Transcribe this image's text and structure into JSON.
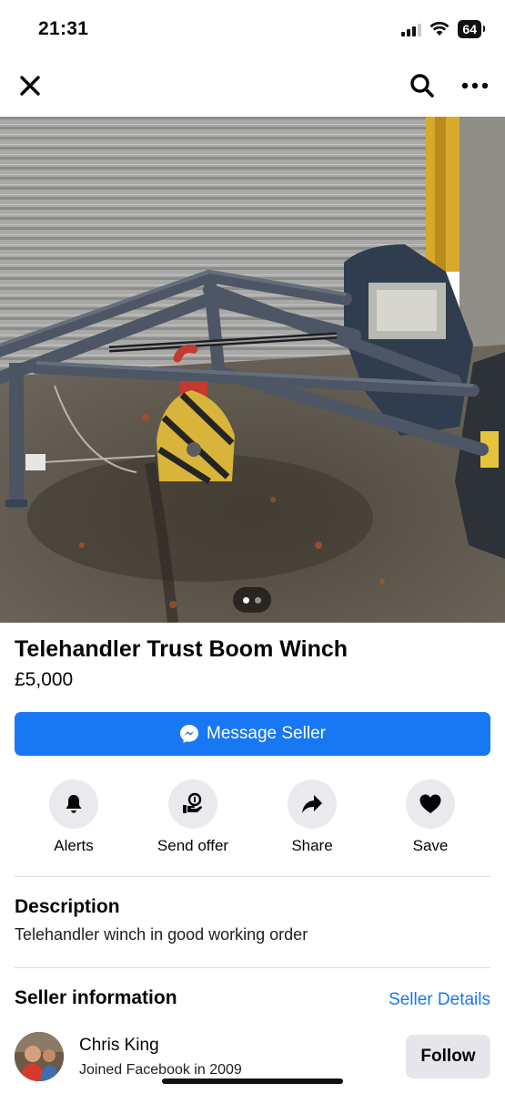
{
  "status_bar": {
    "time": "21:31",
    "battery": "64"
  },
  "listing": {
    "title": "Telehandler Trust Boom Winch",
    "price": "£5,000",
    "photo_count": 2,
    "active_photo": 1
  },
  "message_button": {
    "label": "Message Seller"
  },
  "actions": [
    {
      "label": "Alerts",
      "icon": "bell-icon"
    },
    {
      "label": "Send offer",
      "icon": "offer-icon"
    },
    {
      "label": "Share",
      "icon": "share-arrow-icon"
    },
    {
      "label": "Save",
      "icon": "heart-icon"
    }
  ],
  "description": {
    "heading": "Description",
    "text": "Telehandler winch in good working order"
  },
  "seller": {
    "heading": "Seller information",
    "details_link": "Seller Details",
    "name": "Chris King",
    "joined": "Joined Facebook in 2009",
    "follow_label": "Follow"
  },
  "colors": {
    "accent": "#1877f2",
    "action_bg": "#e9eaee",
    "follow_bg": "#e4e6eb"
  }
}
